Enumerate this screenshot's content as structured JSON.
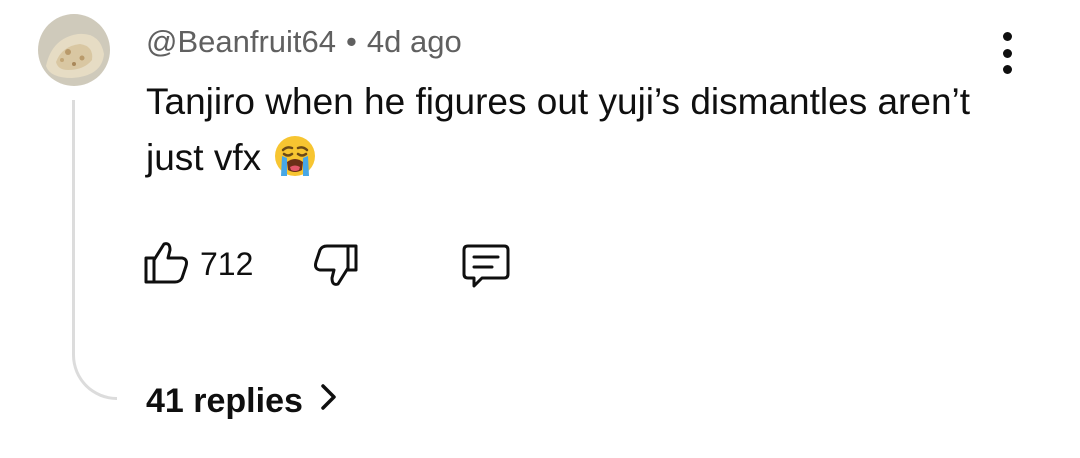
{
  "comment": {
    "author": "@Beanfruit64",
    "separator": "•",
    "timestamp": "4d ago",
    "text": "Tanjiro when he figures out yuji’s dismantles aren’t just vfx",
    "emoji": "loudly-crying-face"
  },
  "actions": {
    "like_count": "712",
    "like_icon": "thumbs-up-icon",
    "dislike_icon": "thumbs-down-icon",
    "reply_icon": "comment-icon",
    "more_icon": "more-vert-icon"
  },
  "replies": {
    "label": "41 replies"
  },
  "colors": {
    "text": "#0f0f0f",
    "meta": "#606060",
    "thread_line": "#dcdcdc"
  }
}
